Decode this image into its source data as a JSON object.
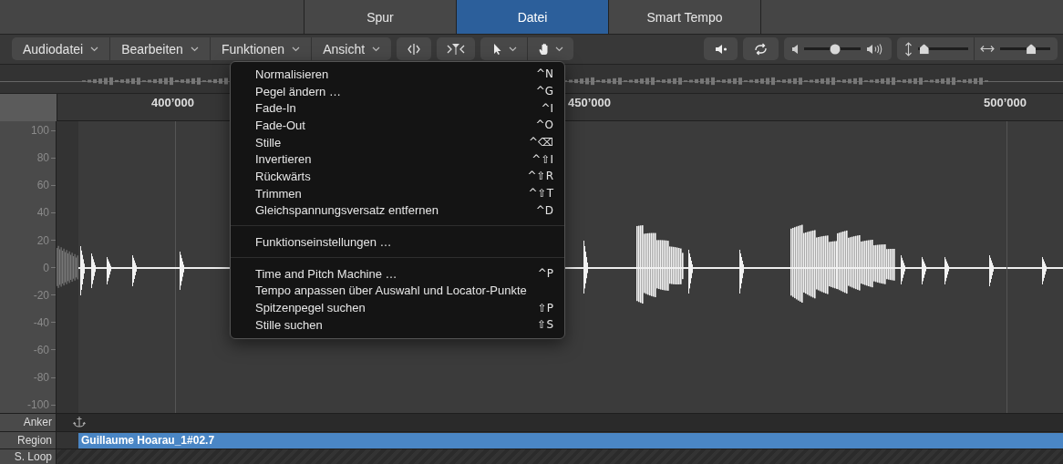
{
  "tabs": [
    {
      "label": "Spur",
      "selected": false
    },
    {
      "label": "Datei",
      "selected": true
    },
    {
      "label": "Smart Tempo",
      "selected": false
    }
  ],
  "toolbar": {
    "menus": [
      "Audiodatei",
      "Bearbeiten",
      "Funktionen",
      "Ansicht"
    ],
    "volume": {
      "level": 0.55
    },
    "vertical_zoom": {
      "level": 0.12
    },
    "horizontal_zoom": {
      "level": 0.62
    }
  },
  "ruler": {
    "labels": [
      "400’000",
      "450’000",
      "500’000"
    ]
  },
  "amplitude_axis": [
    "100",
    "80",
    "60",
    "40",
    "20",
    "0",
    "-20",
    "-40",
    "-60",
    "-80",
    "-100"
  ],
  "menu": {
    "sections": [
      [
        {
          "label": "Normalisieren",
          "shortcut": "^N"
        },
        {
          "label": "Pegel ändern …",
          "shortcut": "^G"
        },
        {
          "label": "Fade-In",
          "shortcut": "^I"
        },
        {
          "label": "Fade-Out",
          "shortcut": "^O"
        },
        {
          "label": "Stille",
          "shortcut": "^⌫"
        },
        {
          "label": "Invertieren",
          "shortcut": "^⇧I"
        },
        {
          "label": "Rückwärts",
          "shortcut": "^⇧R"
        },
        {
          "label": "Trimmen",
          "shortcut": "^⇧T"
        },
        {
          "label": "Gleichspannungsversatz entfernen",
          "shortcut": "^D"
        }
      ],
      [
        {
          "label": "Funktionseinstellungen …"
        }
      ],
      [
        {
          "label": "Time and Pitch Machine …",
          "shortcut": "^P"
        },
        {
          "label": "Tempo anpassen über Auswahl und Locator-Punkte"
        },
        {
          "label": "Spitzenpegel suchen",
          "shortcut": "⇧P"
        },
        {
          "label": "Stille suchen",
          "shortcut": "⇧S"
        }
      ]
    ]
  },
  "lanes": {
    "anchor_label": "Anker",
    "region_label": "Region",
    "loop_label": "S. Loop",
    "region_name": "Guillaume Hoarau_1#02.7"
  }
}
